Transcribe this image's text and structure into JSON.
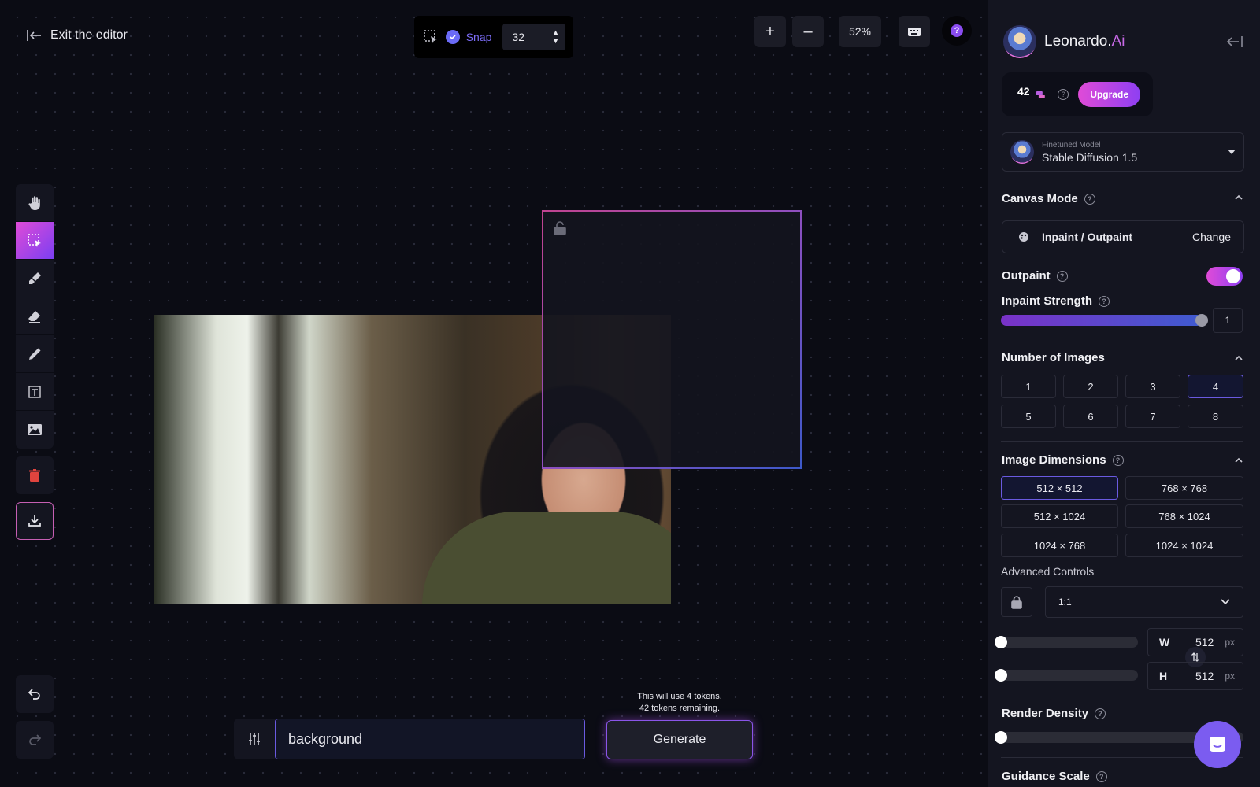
{
  "editor": {
    "exit_label": "Exit the editor"
  },
  "snap": {
    "label": "Snap",
    "value": "32",
    "enabled": true
  },
  "zoom": {
    "zoom_in_label": "+",
    "zoom_out_label": "–",
    "level": "52%"
  },
  "toolbar": {
    "tools": [
      {
        "name": "pan",
        "icon": "hand-icon"
      },
      {
        "name": "select",
        "icon": "select-icon",
        "active": true
      },
      {
        "name": "draw-mask",
        "icon": "mask-brush-icon"
      },
      {
        "name": "erase",
        "icon": "eraser-icon"
      },
      {
        "name": "sketch",
        "icon": "pencil-icon"
      },
      {
        "name": "text",
        "icon": "text-layer-icon"
      },
      {
        "name": "image",
        "icon": "image-icon"
      }
    ]
  },
  "prompt": {
    "value": "background",
    "token_note_line1": "This will use 4 tokens.",
    "token_note_line2": "42 tokens remaining.",
    "generate_label": "Generate"
  },
  "sidebar": {
    "brand_main": "Leonardo.",
    "brand_ai": "Ai",
    "token_count": "42",
    "upgrade_label": "Upgrade",
    "model_subtitle": "Finetuned Model",
    "model_name": "Stable Diffusion 1.5",
    "canvas_mode_title": "Canvas Mode",
    "canvas_mode_value": "Inpaint / Outpaint",
    "change_label": "Change",
    "outpaint_label": "Outpaint",
    "outpaint_enabled": true,
    "inpaint_strength_label": "Inpaint Strength",
    "inpaint_strength_value": "1",
    "number_of_images_title": "Number of Images",
    "image_counts": [
      "1",
      "2",
      "3",
      "4",
      "5",
      "6",
      "7",
      "8"
    ],
    "selected_count": "4",
    "image_dimensions_title": "Image Dimensions",
    "dimensions": [
      "512 × 512",
      "768 × 768",
      "512 × 1024",
      "768 × 1024",
      "1024 × 768",
      "1024 × 1024"
    ],
    "selected_dimension": "512 × 512",
    "advanced_controls_label": "Advanced Controls",
    "aspect_ratio": "1:1",
    "width_label": "W",
    "width_value": "512",
    "height_label": "H",
    "height_value": "512",
    "unit": "px",
    "render_density_title": "Render Density",
    "guidance_scale_title": "Guidance Scale"
  },
  "colors": {
    "accent_gradient_start": "#e04bd7",
    "accent_gradient_end": "#8e3ff2",
    "selection_border": "#6a5ae0",
    "danger": "#e0443e"
  }
}
